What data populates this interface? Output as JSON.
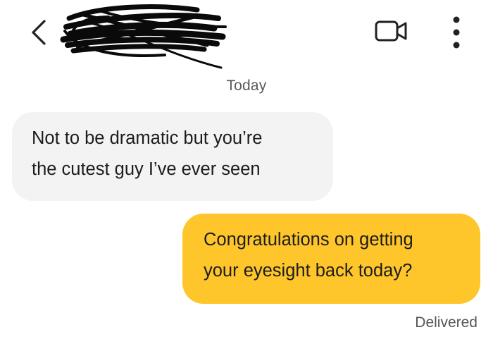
{
  "header": {
    "back_icon": "chevron-left-icon",
    "contact_name": "",
    "video_icon": "video-camera-icon",
    "more_icon": "more-vertical-icon"
  },
  "conversation": {
    "date_separator": "Today",
    "messages": [
      {
        "direction": "incoming",
        "lines": [
          "Not to be dramatic but you’re",
          "the cutest guy I’ve ever seen"
        ]
      },
      {
        "direction": "outgoing",
        "lines": [
          "Congratulations on getting",
          "your eyesight back today?"
        ]
      }
    ],
    "status": "Delivered"
  },
  "colors": {
    "incoming_bubble": "#f3f3f3",
    "outgoing_bubble": "#ffc62b",
    "scribble": "#0a0a0a"
  }
}
